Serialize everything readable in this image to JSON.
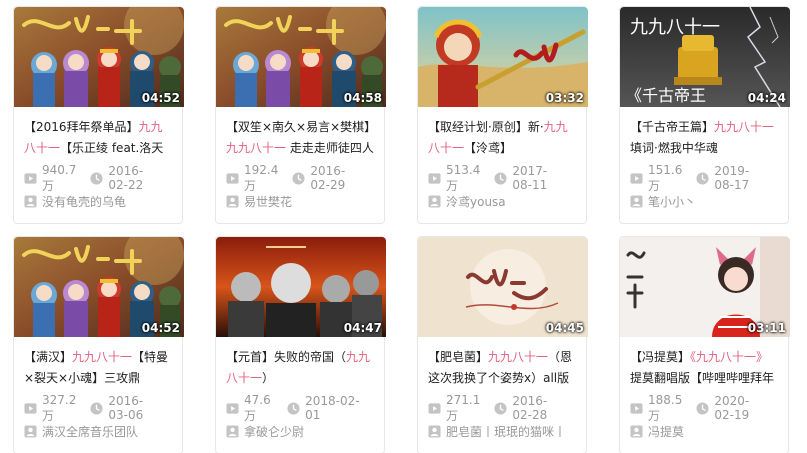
{
  "videos": [
    {
      "duration": "04:52",
      "title_pre": "【2016拜年祭单品】",
      "title_hl": "九九八十一",
      "title_post": "【乐正绫 feat.洛天依",
      "views": "940.7万",
      "date": "2016-02-22",
      "uploader": "没有龟壳的乌龟",
      "thumb_style": "chibi-group",
      "thumb_calligraphy": "九九八十一"
    },
    {
      "duration": "04:58",
      "title_pre": "【双笙×南久×易言×樊棋】",
      "title_hl": "九九八十一",
      "title_post": " 走走走师徒四人",
      "views": "192.4万",
      "date": "2016-02-29",
      "uploader": "易世樊花",
      "thumb_style": "chibi-group",
      "thumb_calligraphy": "九九八十一"
    },
    {
      "duration": "03:32",
      "title_pre": "【取经计划·原创】新·",
      "title_hl": "九九八十一",
      "title_post": "【泠鸢】",
      "views": "513.4万",
      "date": "2017-08-11",
      "uploader": "泠鸢yousa",
      "thumb_style": "monkey-king",
      "thumb_calligraphy": "九九八十一"
    },
    {
      "duration": "04:24",
      "title_pre": "【千古帝王篇】",
      "title_hl": "九九八十一",
      "title_post": "填词·燃我中华魂",
      "views": "151.6万",
      "date": "2019-08-17",
      "uploader": "笔小小丶",
      "thumb_style": "emperor-seal",
      "thumb_top_text": "九九八十一",
      "thumb_bottom_text": "《千古帝王"
    },
    {
      "duration": "04:52",
      "title_pre": "【满汉】",
      "title_hl": "九九八十一",
      "title_post": "【特曼×裂天×小魂】三攻鼎",
      "views": "327.2万",
      "date": "2016-03-06",
      "uploader": "满汉全席音乐团队",
      "thumb_style": "chibi-group",
      "thumb_calligraphy": "九九八十一"
    },
    {
      "duration": "04:47",
      "title_pre": "【元首】失败的帝国（",
      "title_hl": "九九八十一",
      "title_post": "）",
      "views": "47.6万",
      "date": "2018-02-01",
      "uploader": "拿破仑少尉",
      "thumb_style": "leaders",
      "thumb_calligraphy": "九九八十一"
    },
    {
      "duration": "04:45",
      "title_pre": "【肥皂菌】",
      "title_hl": "九九八十一",
      "title_post": "（恩这次我换了个姿势x）all版",
      "views": "271.1万",
      "date": "2016-02-28",
      "uploader": "肥皂菌丨珉珉的猫咪丨",
      "thumb_style": "paper-calligraphy",
      "thumb_calligraphy": "九九八十一"
    },
    {
      "duration": "03:11",
      "title_pre": "【冯提莫】",
      "title_hl": "《九九八十一》",
      "title_post": "提莫翻唱版【哔哩哔哩拜年",
      "views": "188.5万",
      "date": "2020-02-19",
      "uploader": "冯提莫",
      "thumb_style": "singer",
      "thumb_calligraphy": "九九八十一"
    }
  ]
}
